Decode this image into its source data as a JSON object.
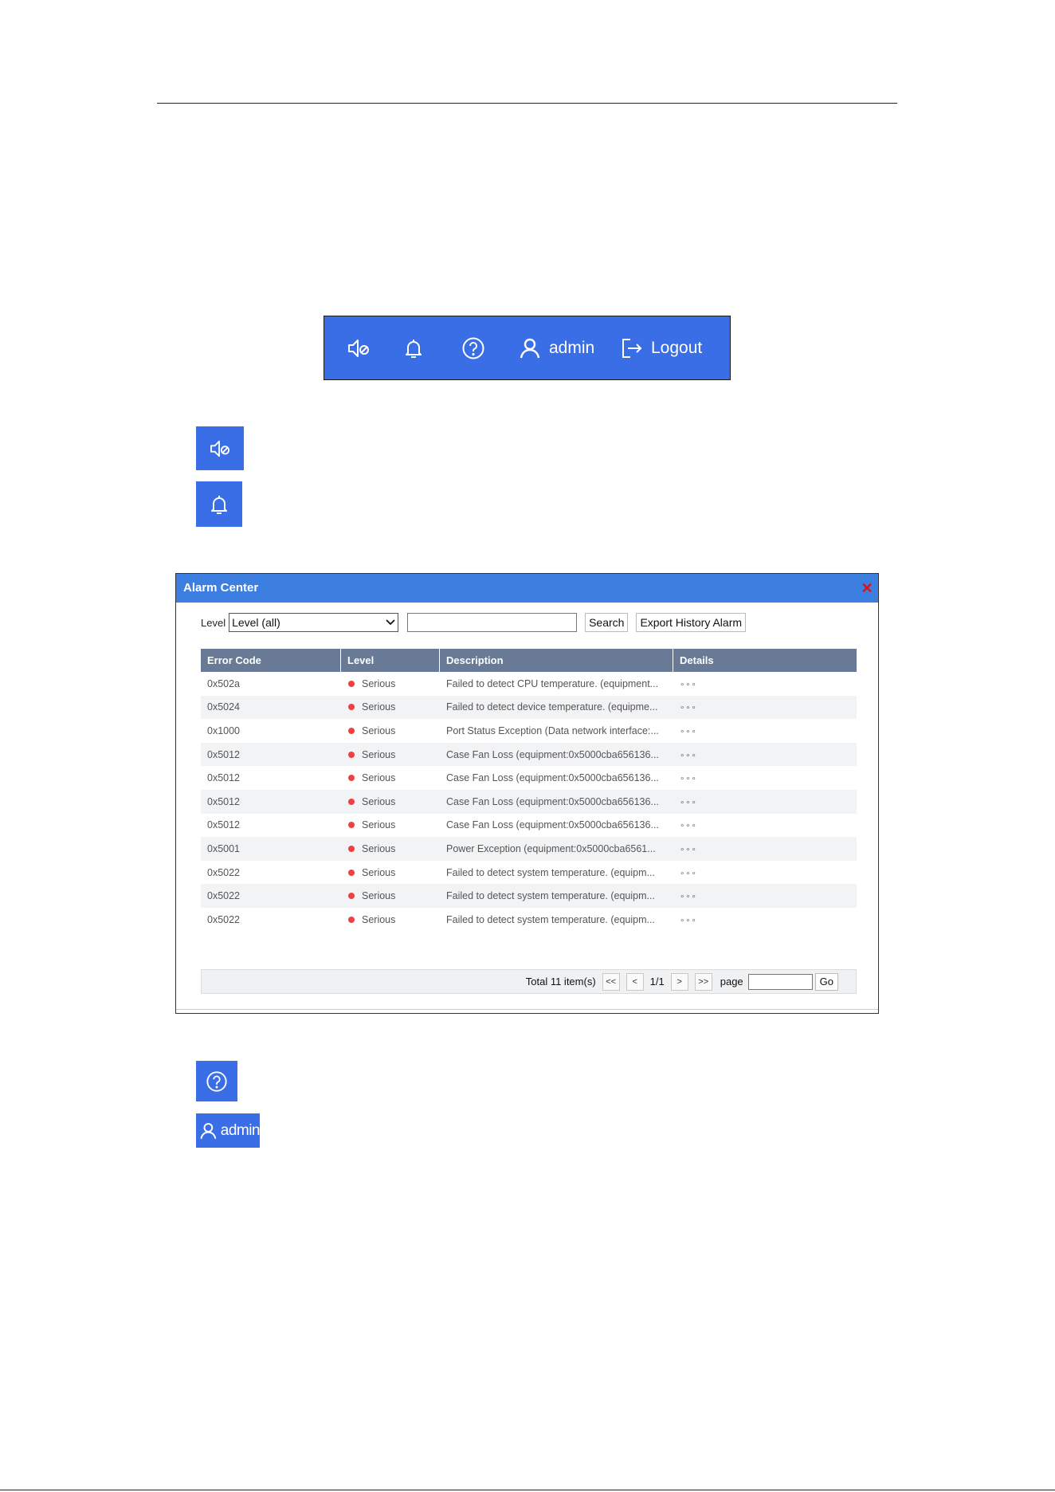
{
  "toolbar": {
    "icons": [
      "mute-icon",
      "bell-icon",
      "help-icon",
      "user-icon",
      "logout-icon"
    ],
    "user_label": "admin",
    "logout_label": "Logout",
    "color": "#3a6ee6"
  },
  "tiles": {
    "admin_label": "admin"
  },
  "alarm_center": {
    "title": "Alarm Center",
    "title_bar_color": "#3d7ee1",
    "filter": {
      "level_label": "Level",
      "level_selected": "Level (all)",
      "search_value": "",
      "search_button": "Search",
      "export_button": "Export History Alarm"
    },
    "columns": [
      "Error Code",
      "Level",
      "Description",
      "Details"
    ],
    "rows": [
      {
        "code": "0x502a",
        "level": "Serious",
        "description": "Failed to detect CPU temperature. (equipment...",
        "details": "∘∘∘"
      },
      {
        "code": "0x5024",
        "level": "Serious",
        "description": "Failed to detect device temperature. (equipme...",
        "details": "∘∘∘"
      },
      {
        "code": "0x1000",
        "level": "Serious",
        "description": "Port Status Exception (Data network interface:...",
        "details": "∘∘∘"
      },
      {
        "code": "0x5012",
        "level": "Serious",
        "description": "Case Fan Loss (equipment:0x5000cba656136...",
        "details": "∘∘∘"
      },
      {
        "code": "0x5012",
        "level": "Serious",
        "description": "Case Fan Loss (equipment:0x5000cba656136...",
        "details": "∘∘∘"
      },
      {
        "code": "0x5012",
        "level": "Serious",
        "description": "Case Fan Loss (equipment:0x5000cba656136...",
        "details": "∘∘∘"
      },
      {
        "code": "0x5012",
        "level": "Serious",
        "description": "Case Fan Loss (equipment:0x5000cba656136...",
        "details": "∘∘∘"
      },
      {
        "code": "0x5001",
        "level": "Serious",
        "description": "Power Exception (equipment:0x5000cba6561...",
        "details": "∘∘∘"
      },
      {
        "code": "0x5022",
        "level": "Serious",
        "description": "Failed to detect system temperature. (equipm...",
        "details": "∘∘∘"
      },
      {
        "code": "0x5022",
        "level": "Serious",
        "description": "Failed to detect system temperature. (equipm...",
        "details": "∘∘∘"
      },
      {
        "code": "0x5022",
        "level": "Serious",
        "description": "Failed to detect system temperature. (equipm...",
        "details": "∘∘∘"
      }
    ],
    "status_color": "#f04040",
    "pager": {
      "total": "Total 11 item(s)",
      "first": "<<",
      "prev": "<",
      "page_info": "1/1",
      "next": ">",
      "last": ">>",
      "page_label": "page",
      "page_value": "",
      "go": "Go"
    }
  }
}
